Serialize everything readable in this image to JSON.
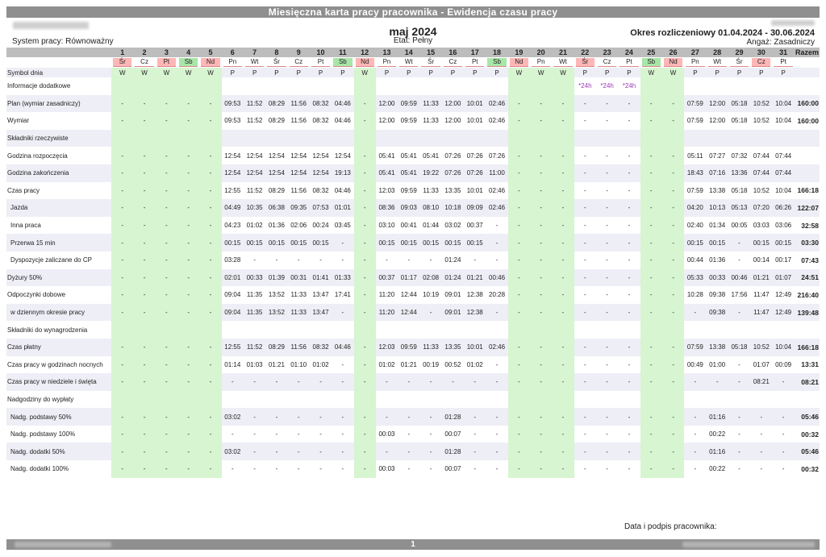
{
  "title": "Miesięczna karta pracy pracownika - Ewidencja czasu pracy",
  "month": "maj 2024",
  "etat": "Etat: Pełny",
  "system": "System pracy: Równoważny",
  "okres": "Okres rozliczeniowy 01.04.2024 - 30.06.2024",
  "angaz": "Angaż: Zasadniczy",
  "total_header": "Razem",
  "podpis": "Data i podpis pracownika:",
  "page": "1",
  "colors": {
    "header_bar": "#8f8f8f",
    "weekend_column": "#d6f5d0",
    "weekday_red": "#ffb6b6",
    "weekday_green": "#a8e6a8",
    "purple": "#9b3bb5"
  },
  "days": [
    "1",
    "2",
    "3",
    "4",
    "5",
    "6",
    "7",
    "8",
    "9",
    "10",
    "11",
    "12",
    "13",
    "14",
    "15",
    "16",
    "17",
    "18",
    "19",
    "20",
    "21",
    "22",
    "23",
    "24",
    "25",
    "26",
    "27",
    "28",
    "29",
    "30",
    "31"
  ],
  "weekdays": [
    "Śr",
    "Cz",
    "Pt",
    "Sb",
    "Nd",
    "Pn",
    "Wt",
    "Śr",
    "Cz",
    "Pt",
    "Sb",
    "Nd",
    "Pn",
    "Wt",
    "Śr",
    "Cz",
    "Pt",
    "Sb",
    "Nd",
    "Pn",
    "Wt",
    "Śr",
    "Cz",
    "Pt",
    "Sb",
    "Nd",
    "Pn",
    "Wt",
    "Śr",
    "Cz",
    "Pt"
  ],
  "weekday_colors": [
    "sr",
    "",
    "sr",
    "sb",
    "nd",
    "",
    "",
    "",
    "",
    "",
    "sb",
    "nd",
    "",
    "",
    "",
    "",
    "",
    "sb",
    "nd",
    "",
    "",
    "sr",
    "",
    "",
    "sb",
    "nd",
    "",
    "",
    "",
    "sr",
    ""
  ],
  "green_columns": [
    0,
    1,
    2,
    3,
    4,
    11,
    18,
    19,
    20,
    24,
    25
  ],
  "symbols": [
    "W",
    "W",
    "W",
    "W",
    "W",
    "P",
    "P",
    "P",
    "P",
    "P",
    "P",
    "W",
    "P",
    "P",
    "P",
    "P",
    "P",
    "P",
    "W",
    "W",
    "W",
    "P",
    "P",
    "P",
    "W",
    "W",
    "P",
    "P",
    "P",
    "P",
    "P"
  ],
  "symbols_label": "Symbol dnia",
  "rows": [
    {
      "label": "Informacje dodatkowe",
      "ind": false,
      "purple": true,
      "values": [
        "",
        "",
        "",
        "",
        "",
        "",
        "",
        "",
        "",
        "",
        "",
        "",
        "",
        "",
        "",
        "",
        "",
        "",
        "",
        "",
        "",
        "*24h",
        "*24h",
        "*24h",
        "",
        "",
        "",
        "",
        "",
        "",
        ""
      ],
      "total": ""
    },
    {
      "label": "Plan (wymiar zasadniczy)",
      "values": [
        "-",
        "-",
        "-",
        "-",
        "-",
        "09:53",
        "11:52",
        "08:29",
        "11:56",
        "08:32",
        "04:46",
        "-",
        "12:00",
        "09:59",
        "11:33",
        "12:00",
        "10:01",
        "02:46",
        "-",
        "-",
        "-",
        "-",
        "-",
        "-",
        "-",
        "-",
        "07:59",
        "12:00",
        "05:18",
        "10:52",
        "10:04"
      ],
      "total": "160:00"
    },
    {
      "label": "Wymiar",
      "values": [
        "-",
        "-",
        "-",
        "-",
        "-",
        "09:53",
        "11:52",
        "08:29",
        "11:56",
        "08:32",
        "04:46",
        "-",
        "12:00",
        "09:59",
        "11:33",
        "12:00",
        "10:01",
        "02:46",
        "-",
        "-",
        "-",
        "-",
        "-",
        "-",
        "-",
        "-",
        "07:59",
        "12:00",
        "05:18",
        "10:52",
        "10:04"
      ],
      "total": "160:00"
    },
    {
      "label": "Składniki rzeczywiste",
      "values": [
        "",
        "",
        "",
        "",
        "",
        "",
        "",
        "",
        "",
        "",
        "",
        "",
        "",
        "",
        "",
        "",
        "",
        "",
        "",
        "",
        "",
        "",
        "",
        "",
        "",
        "",
        "",
        "",
        "",
        "",
        ""
      ],
      "total": ""
    },
    {
      "label": "Godzina rozpoczęcia",
      "values": [
        "-",
        "-",
        "-",
        "-",
        "-",
        "12:54",
        "12:54",
        "12:54",
        "12:54",
        "12:54",
        "12:54",
        "-",
        "05:41",
        "05:41",
        "05:41",
        "07:26",
        "07:26",
        "07:26",
        "-",
        "-",
        "-",
        "-",
        "-",
        "-",
        "-",
        "-",
        "05:11",
        "07:27",
        "07:32",
        "07:44",
        "07:44"
      ],
      "total": ""
    },
    {
      "label": "Godzina zakończenia",
      "values": [
        "-",
        "-",
        "-",
        "-",
        "-",
        "12:54",
        "12:54",
        "12:54",
        "12:54",
        "12:54",
        "19:13",
        "-",
        "05:41",
        "05:41",
        "19:22",
        "07:26",
        "07:26",
        "11:00",
        "-",
        "-",
        "-",
        "-",
        "-",
        "-",
        "-",
        "-",
        "18:43",
        "07:16",
        "13:36",
        "07:44",
        "07:44"
      ],
      "total": ""
    },
    {
      "label": "Czas pracy",
      "values": [
        "-",
        "-",
        "-",
        "-",
        "-",
        "12:55",
        "11:52",
        "08:29",
        "11:56",
        "08:32",
        "04:46",
        "-",
        "12:03",
        "09:59",
        "11:33",
        "13:35",
        "10:01",
        "02:46",
        "-",
        "-",
        "-",
        "-",
        "-",
        "-",
        "-",
        "-",
        "07:59",
        "13:38",
        "05:18",
        "10:52",
        "10:04"
      ],
      "total": "166:18"
    },
    {
      "label": "Jazda",
      "ind": true,
      "values": [
        "-",
        "-",
        "-",
        "-",
        "-",
        "04:49",
        "10:35",
        "06:38",
        "09:35",
        "07:53",
        "01:01",
        "-",
        "08:36",
        "09:03",
        "08:10",
        "10:18",
        "09:09",
        "02:46",
        "-",
        "-",
        "-",
        "-",
        "-",
        "-",
        "-",
        "-",
        "04:20",
        "10:13",
        "05:13",
        "07:20",
        "06:26"
      ],
      "total": "122:07"
    },
    {
      "label": "Inna praca",
      "ind": true,
      "values": [
        "-",
        "-",
        "-",
        "-",
        "-",
        "04:23",
        "01:02",
        "01:36",
        "02:06",
        "00:24",
        "03:45",
        "-",
        "03:10",
        "00:41",
        "01:44",
        "03:02",
        "00:37",
        "-",
        "-",
        "-",
        "-",
        "-",
        "-",
        "-",
        "-",
        "-",
        "02:40",
        "01:34",
        "00:05",
        "03:03",
        "03:06"
      ],
      "total": "32:58"
    },
    {
      "label": "Przerwa 15 min",
      "ind": true,
      "values": [
        "-",
        "-",
        "-",
        "-",
        "-",
        "00:15",
        "00:15",
        "00:15",
        "00:15",
        "00:15",
        "-",
        "-",
        "00:15",
        "00:15",
        "00:15",
        "00:15",
        "00:15",
        "-",
        "-",
        "-",
        "-",
        "-",
        "-",
        "-",
        "-",
        "-",
        "00:15",
        "00:15",
        "-",
        "00:15",
        "00:15"
      ],
      "total": "03:30"
    },
    {
      "label": "Dyspozycje zaliczane do CP",
      "ind": true,
      "values": [
        "-",
        "-",
        "-",
        "-",
        "-",
        "03:28",
        "-",
        "-",
        "-",
        "-",
        "-",
        "-",
        "-",
        "-",
        "-",
        "01:24",
        "-",
        "-",
        "-",
        "-",
        "-",
        "-",
        "-",
        "-",
        "-",
        "-",
        "00:44",
        "01:36",
        "-",
        "00:14",
        "00:17"
      ],
      "total": "07:43"
    },
    {
      "label": "Dyżury 50%",
      "values": [
        "-",
        "-",
        "-",
        "-",
        "-",
        "02:01",
        "00:33",
        "01:39",
        "00:31",
        "01:41",
        "01:33",
        "-",
        "00:37",
        "01:17",
        "02:08",
        "01:24",
        "01:21",
        "00:46",
        "-",
        "-",
        "-",
        "-",
        "-",
        "-",
        "-",
        "-",
        "05:33",
        "00:33",
        "00:46",
        "01:21",
        "01:07"
      ],
      "total": "24:51"
    },
    {
      "label": "Odpoczynki dobowe",
      "values": [
        "-",
        "-",
        "-",
        "-",
        "-",
        "09:04",
        "11:35",
        "13:52",
        "11:33",
        "13:47",
        "17:41",
        "-",
        "11:20",
        "12:44",
        "10:19",
        "09:01",
        "12:38",
        "20:28",
        "-",
        "-",
        "-",
        "-",
        "-",
        "-",
        "-",
        "-",
        "10:28",
        "09:38",
        "17:56",
        "11:47",
        "12:49"
      ],
      "total": "216:40"
    },
    {
      "label": "w dziennym okresie pracy",
      "ind": true,
      "values": [
        "-",
        "-",
        "-",
        "-",
        "-",
        "09:04",
        "11:35",
        "13:52",
        "11:33",
        "13:47",
        "-",
        "-",
        "11:20",
        "12:44",
        "-",
        "09:01",
        "12:38",
        "-",
        "-",
        "-",
        "-",
        "-",
        "-",
        "-",
        "-",
        "-",
        "-",
        "09:38",
        "-",
        "11:47",
        "12:49"
      ],
      "total": "139:48"
    },
    {
      "label": "Składniki do wynagrodzenia",
      "values": [
        "",
        "",
        "",
        "",
        "",
        "",
        "",
        "",
        "",
        "",
        "",
        "",
        "",
        "",
        "",
        "",
        "",
        "",
        "",
        "",
        "",
        "",
        "",
        "",
        "",
        "",
        "",
        "",
        "",
        "",
        ""
      ],
      "total": ""
    },
    {
      "label": "Czas płatny",
      "values": [
        "-",
        "-",
        "-",
        "-",
        "-",
        "12:55",
        "11:52",
        "08:29",
        "11:56",
        "08:32",
        "04:46",
        "-",
        "12:03",
        "09:59",
        "11:33",
        "13:35",
        "10:01",
        "02:46",
        "-",
        "-",
        "-",
        "-",
        "-",
        "-",
        "-",
        "-",
        "07:59",
        "13:38",
        "05:18",
        "10:52",
        "10:04"
      ],
      "total": "166:18"
    },
    {
      "label": "Czas pracy w godzinach nocnych",
      "values": [
        "-",
        "-",
        "-",
        "-",
        "-",
        "01:14",
        "01:03",
        "01:21",
        "01:10",
        "01:02",
        "-",
        "-",
        "01:02",
        "01:21",
        "00:19",
        "00:52",
        "01:02",
        "-",
        "-",
        "-",
        "-",
        "-",
        "-",
        "-",
        "-",
        "-",
        "00:49",
        "01:00",
        "-",
        "01:07",
        "00:09"
      ],
      "total": "13:31"
    },
    {
      "label": "Czas pracy w niedziele i święta",
      "values": [
        "-",
        "-",
        "-",
        "-",
        "-",
        "-",
        "-",
        "-",
        "-",
        "-",
        "-",
        "-",
        "-",
        "-",
        "-",
        "-",
        "-",
        "-",
        "-",
        "-",
        "-",
        "-",
        "-",
        "-",
        "-",
        "-",
        "-",
        "-",
        "-",
        "08:21",
        "-"
      ],
      "total": "08:21"
    },
    {
      "label": "Nadgodziny do wypłaty",
      "values": [
        "",
        "",
        "",
        "",
        "",
        "",
        "",
        "",
        "",
        "",
        "",
        "",
        "",
        "",
        "",
        "",
        "",
        "",
        "",
        "",
        "",
        "",
        "",
        "",
        "",
        "",
        "",
        "",
        "",
        "",
        ""
      ],
      "total": ""
    },
    {
      "label": "Nadg. podstawy 50%",
      "ind": true,
      "values": [
        "-",
        "-",
        "-",
        "-",
        "-",
        "03:02",
        "-",
        "-",
        "-",
        "-",
        "-",
        "-",
        "-",
        "-",
        "-",
        "01:28",
        "-",
        "-",
        "-",
        "-",
        "-",
        "-",
        "-",
        "-",
        "-",
        "-",
        "-",
        "01:16",
        "-",
        "-",
        "-"
      ],
      "total": "05:46"
    },
    {
      "label": "Nadg. podstawy 100%",
      "ind": true,
      "values": [
        "-",
        "-",
        "-",
        "-",
        "-",
        "-",
        "-",
        "-",
        "-",
        "-",
        "-",
        "-",
        "00:03",
        "-",
        "-",
        "00:07",
        "-",
        "-",
        "-",
        "-",
        "-",
        "-",
        "-",
        "-",
        "-",
        "-",
        "-",
        "00:22",
        "-",
        "-",
        "-"
      ],
      "total": "00:32"
    },
    {
      "label": "Nadg. dodatki 50%",
      "ind": true,
      "values": [
        "-",
        "-",
        "-",
        "-",
        "-",
        "03:02",
        "-",
        "-",
        "-",
        "-",
        "-",
        "-",
        "-",
        "-",
        "-",
        "01:28",
        "-",
        "-",
        "-",
        "-",
        "-",
        "-",
        "-",
        "-",
        "-",
        "-",
        "-",
        "01:16",
        "-",
        "-",
        "-"
      ],
      "total": "05:46"
    },
    {
      "label": "Nadg. dodatki 100%",
      "ind": true,
      "values": [
        "-",
        "-",
        "-",
        "-",
        "-",
        "-",
        "-",
        "-",
        "-",
        "-",
        "-",
        "-",
        "00:03",
        "-",
        "-",
        "00:07",
        "-",
        "-",
        "-",
        "-",
        "-",
        "-",
        "-",
        "-",
        "-",
        "-",
        "-",
        "00:22",
        "-",
        "-",
        "-"
      ],
      "total": "00:32"
    }
  ]
}
